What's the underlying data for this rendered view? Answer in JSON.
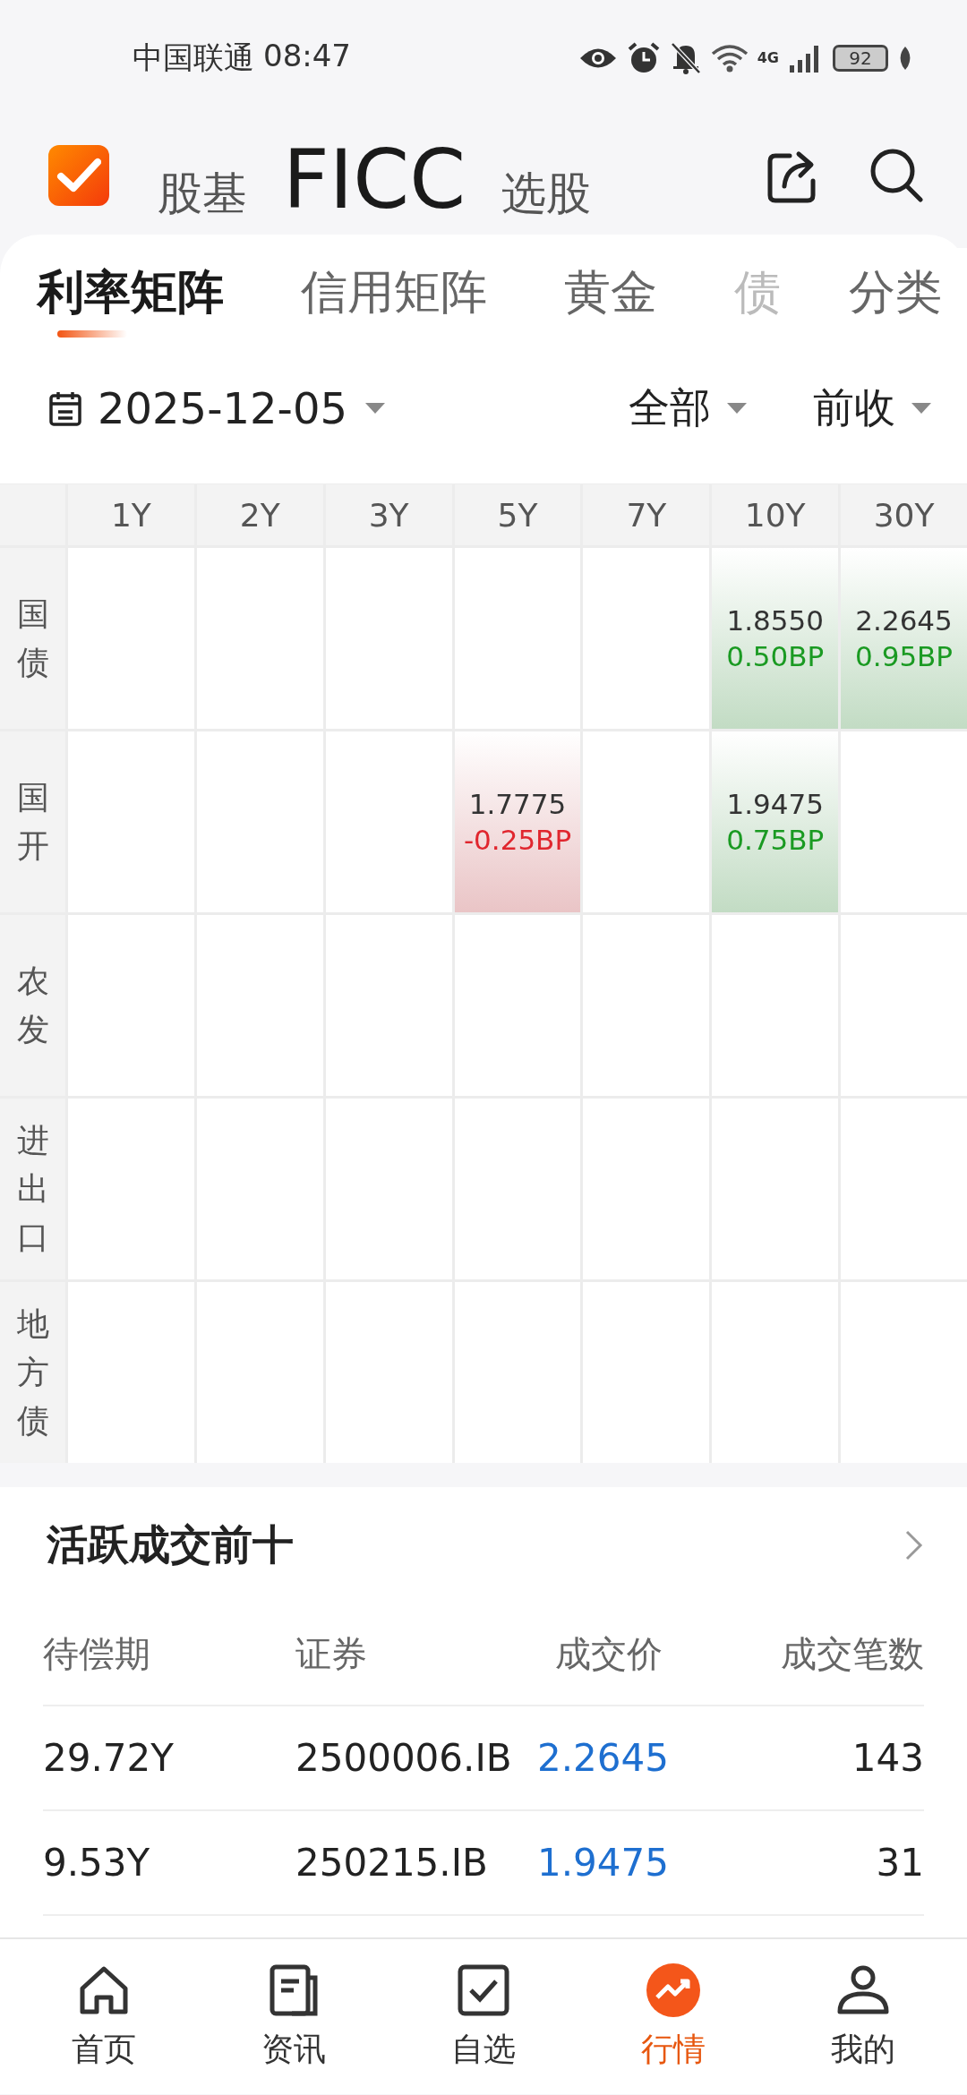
{
  "status_bar": {
    "carrier": "中国联通",
    "time": "08:47",
    "network": "4G",
    "battery": "92"
  },
  "header": {
    "tabs": [
      {
        "label": "股基",
        "selected": false
      },
      {
        "label": "FICC",
        "selected": true
      },
      {
        "label": "选股",
        "selected": false
      }
    ]
  },
  "tabs": [
    {
      "label": "利率矩阵",
      "selected": true
    },
    {
      "label": "信用矩阵",
      "selected": false
    },
    {
      "label": "黄金",
      "selected": false
    },
    {
      "label": "债",
      "selected": false
    }
  ],
  "category_button": "分类",
  "filters": {
    "date": "2025-12-05",
    "scope": "全部",
    "basis": "前收"
  },
  "matrix": {
    "columns": [
      "1Y",
      "2Y",
      "3Y",
      "5Y",
      "7Y",
      "10Y",
      "30Y"
    ],
    "rows": [
      {
        "label": "国债",
        "cells": [
          {
            "kind": "empty"
          },
          {
            "kind": "empty"
          },
          {
            "kind": "empty"
          },
          {
            "kind": "empty"
          },
          {
            "kind": "empty"
          },
          {
            "kind": "quote",
            "value": "1.8550",
            "change": "0.50BP",
            "color": "#1a9a22"
          },
          {
            "kind": "quote",
            "value": "2.2645",
            "change": "0.95BP",
            "color": "#1a9a22"
          }
        ]
      },
      {
        "label": "国开",
        "cells": [
          {
            "kind": "empty"
          },
          {
            "kind": "empty"
          },
          {
            "kind": "empty"
          },
          {
            "kind": "quote",
            "value": "1.7775",
            "change": "-0.25BP",
            "color": "#e0262e"
          },
          {
            "kind": "empty"
          },
          {
            "kind": "quote",
            "value": "1.9475",
            "change": "0.75BP",
            "color": "#1a9a22"
          },
          {
            "kind": "empty"
          }
        ]
      },
      {
        "label": "农发",
        "cells": [
          {
            "kind": "empty"
          },
          {
            "kind": "empty"
          },
          {
            "kind": "empty"
          },
          {
            "kind": "empty"
          },
          {
            "kind": "empty"
          },
          {
            "kind": "empty"
          },
          {
            "kind": "empty"
          }
        ]
      },
      {
        "label": "进出口",
        "cells": [
          {
            "kind": "empty"
          },
          {
            "kind": "empty"
          },
          {
            "kind": "empty"
          },
          {
            "kind": "empty"
          },
          {
            "kind": "empty"
          },
          {
            "kind": "empty"
          },
          {
            "kind": "empty"
          }
        ]
      },
      {
        "label": "地方债",
        "cells": [
          {
            "kind": "empty"
          },
          {
            "kind": "empty"
          },
          {
            "kind": "empty"
          },
          {
            "kind": "empty"
          },
          {
            "kind": "empty"
          },
          {
            "kind": "empty"
          },
          {
            "kind": "empty"
          }
        ]
      }
    ]
  },
  "active_trades": {
    "title": "活跃成交前十",
    "columns": [
      "待偿期",
      "证券",
      "成交价",
      "成交笔数"
    ],
    "rows": [
      {
        "term": "29.72Y",
        "security": "2500006.IB",
        "price": "2.2645",
        "count": "143"
      },
      {
        "term": "9.53Y",
        "security": "250215.IB",
        "price": "1.9475",
        "count": "31"
      }
    ]
  },
  "bottom_nav": [
    {
      "label": "首页",
      "selected": false
    },
    {
      "label": "资讯",
      "selected": false
    },
    {
      "label": "自选",
      "selected": false
    },
    {
      "label": "行情",
      "selected": true
    },
    {
      "label": "我的",
      "selected": false
    }
  ]
}
